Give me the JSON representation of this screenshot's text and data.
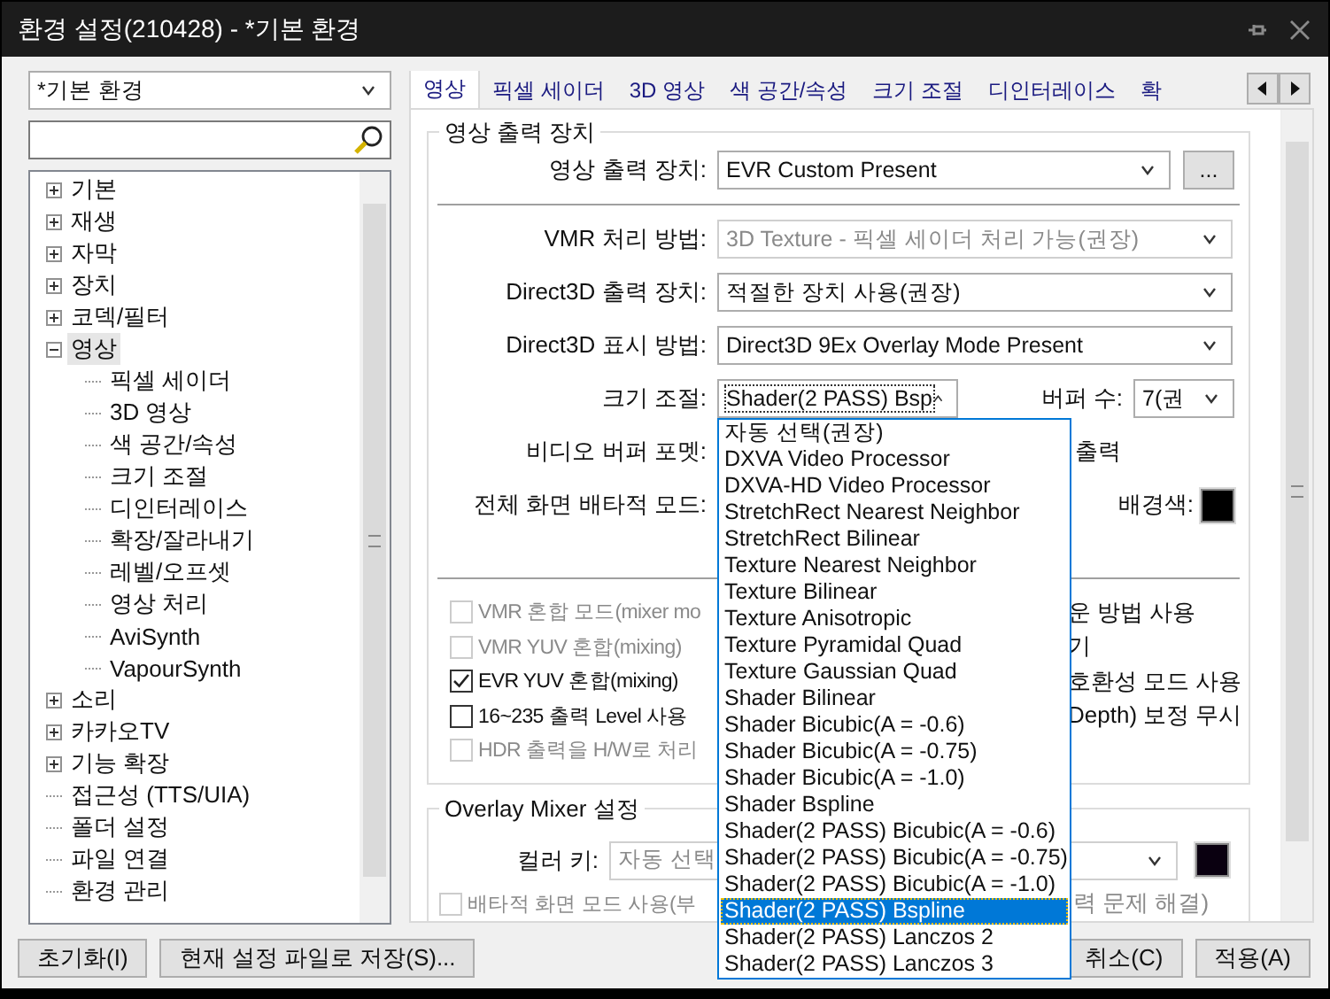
{
  "window": {
    "title": "환경 설정(210428) - *기본 환경"
  },
  "preset": {
    "value": "*기본 환경"
  },
  "tree": [
    {
      "label": "기본",
      "expanded": false,
      "selected": false
    },
    {
      "label": "재생",
      "expanded": false,
      "selected": false
    },
    {
      "label": "자막",
      "expanded": false,
      "selected": false
    },
    {
      "label": "장치",
      "expanded": false,
      "selected": false
    },
    {
      "label": "코덱/필터",
      "expanded": false,
      "selected": false
    },
    {
      "label": "영상",
      "expanded": true,
      "selected": true,
      "children": [
        {
          "label": "픽셀 세이더",
          "selected": false
        },
        {
          "label": "3D 영상",
          "selected": false
        },
        {
          "label": "색 공간/속성",
          "selected": false
        },
        {
          "label": "크기 조절",
          "selected": false
        },
        {
          "label": "디인터레이스",
          "selected": false
        },
        {
          "label": "확장/잘라내기",
          "selected": false
        },
        {
          "label": "레벨/오프셋",
          "selected": false
        },
        {
          "label": "영상 처리",
          "selected": false
        },
        {
          "label": "AviSynth",
          "selected": false
        },
        {
          "label": "VapourSynth",
          "selected": false
        }
      ]
    },
    {
      "label": "소리",
      "expanded": false,
      "selected": false
    },
    {
      "label": "카카오TV",
      "expanded": false,
      "selected": false
    },
    {
      "label": "기능 확장",
      "expanded": false,
      "selected": false
    },
    {
      "label": "접근성 (TTS/UIA)",
      "selected": false
    },
    {
      "label": "폴더 설정",
      "selected": false
    },
    {
      "label": "파일 연결",
      "selected": false
    },
    {
      "label": "환경 관리",
      "selected": false
    }
  ],
  "tabs": [
    {
      "label": "영상",
      "selected": true
    },
    {
      "label": "픽셀 세이더",
      "selected": false
    },
    {
      "label": "3D 영상",
      "selected": false
    },
    {
      "label": "색 공간/속성",
      "selected": false
    },
    {
      "label": "크기 조절",
      "selected": false
    },
    {
      "label": "디인터레이스",
      "selected": false
    },
    {
      "label": "확",
      "selected": false
    }
  ],
  "video_output": {
    "title": "영상 출력 장치",
    "device": {
      "label": "영상 출력 장치:",
      "value": "EVR Custom Present",
      "button": "..."
    },
    "selects": [
      {
        "label": "VMR 처리 방법:",
        "value": "3D Texture - 픽셀 세이더 처리 가능(권장)",
        "disabled": true
      },
      {
        "label": "Direct3D 출력 장치:",
        "value": "적절한 장치 사용(권장)",
        "disabled": false
      },
      {
        "label": "Direct3D 표시 방법:",
        "value": "Direct3D 9Ex Overlay Mode Present",
        "disabled": false
      }
    ],
    "resize": {
      "label": "크기 조절:",
      "value": "Shader(2 PASS) Bsp",
      "expanded": true,
      "options": [
        {
          "label": "자동 선택(권장)",
          "selected": false
        },
        {
          "label": "DXVA Video Processor",
          "selected": false
        },
        {
          "label": "DXVA-HD Video Processor",
          "selected": false
        },
        {
          "label": "StretchRect Nearest Neighbor",
          "selected": false
        },
        {
          "label": "StretchRect Bilinear",
          "selected": false
        },
        {
          "label": "Texture Nearest Neighbor",
          "selected": false
        },
        {
          "label": "Texture Bilinear",
          "selected": false
        },
        {
          "label": "Texture Anisotropic",
          "selected": false
        },
        {
          "label": "Texture Pyramidal Quad",
          "selected": false
        },
        {
          "label": "Texture Gaussian Quad",
          "selected": false
        },
        {
          "label": "Shader Bilinear",
          "selected": false
        },
        {
          "label": "Shader Bicubic(A = -0.6)",
          "selected": false
        },
        {
          "label": "Shader Bicubic(A = -0.75)",
          "selected": false
        },
        {
          "label": "Shader Bicubic(A = -1.0)",
          "selected": false
        },
        {
          "label": "Shader Bspline",
          "selected": false
        },
        {
          "label": "Shader(2 PASS) Bicubic(A = -0.6)",
          "selected": false
        },
        {
          "label": "Shader(2 PASS) Bicubic(A = -0.75)",
          "selected": false
        },
        {
          "label": "Shader(2 PASS) Bicubic(A = -1.0)",
          "selected": false
        },
        {
          "label": "Shader(2 PASS) Bspline",
          "selected": true
        },
        {
          "label": "Shader(2 PASS) Lanczos 2",
          "selected": false
        },
        {
          "label": "Shader(2 PASS) Lanczos 3",
          "selected": false
        }
      ]
    },
    "buffer": {
      "label": "버퍼 수:",
      "value": "7(권"
    },
    "buffer_format": {
      "label": "비디오 버퍼 포멧:",
      "trailing": "출력"
    },
    "exclusive": {
      "label": "전체 화면 배타적 모드:",
      "bg_label": "배경색:",
      "color": "#000000"
    },
    "checkboxes": [
      {
        "label": "VMR 혼합 모드(mixer mo",
        "checked": false,
        "disabled": true,
        "trailing": "운 방법 사용"
      },
      {
        "label": "VMR YUV 혼합(mixing)",
        "checked": false,
        "disabled": true,
        "trailing": "기"
      },
      {
        "label": "EVR YUV 혼합(mixing)",
        "checked": true,
        "disabled": false,
        "trailing": "호환성 모드 사용"
      },
      {
        "label": "16~235 출력 Level 사용",
        "checked": false,
        "disabled": false,
        "trailing": "Depth) 보정 무시"
      },
      {
        "label": "HDR 출력을 H/W로 처리",
        "checked": false,
        "disabled": true
      }
    ]
  },
  "overlay": {
    "title": "Overlay Mixer 설정",
    "color_key": {
      "label": "컬러 키:",
      "value": "자동 선택",
      "color": "#0a0010"
    },
    "checkbox": {
      "label": "배타적 화면 모드 사용(부",
      "checked": false,
      "disabled": true,
      "trailing": "력 문제 해결)"
    }
  },
  "buttons_left": [
    "초기화(I)",
    "현재 설정 파일로 저장(S)..."
  ],
  "buttons_right": [
    "취소(C)",
    "적용(A)"
  ]
}
